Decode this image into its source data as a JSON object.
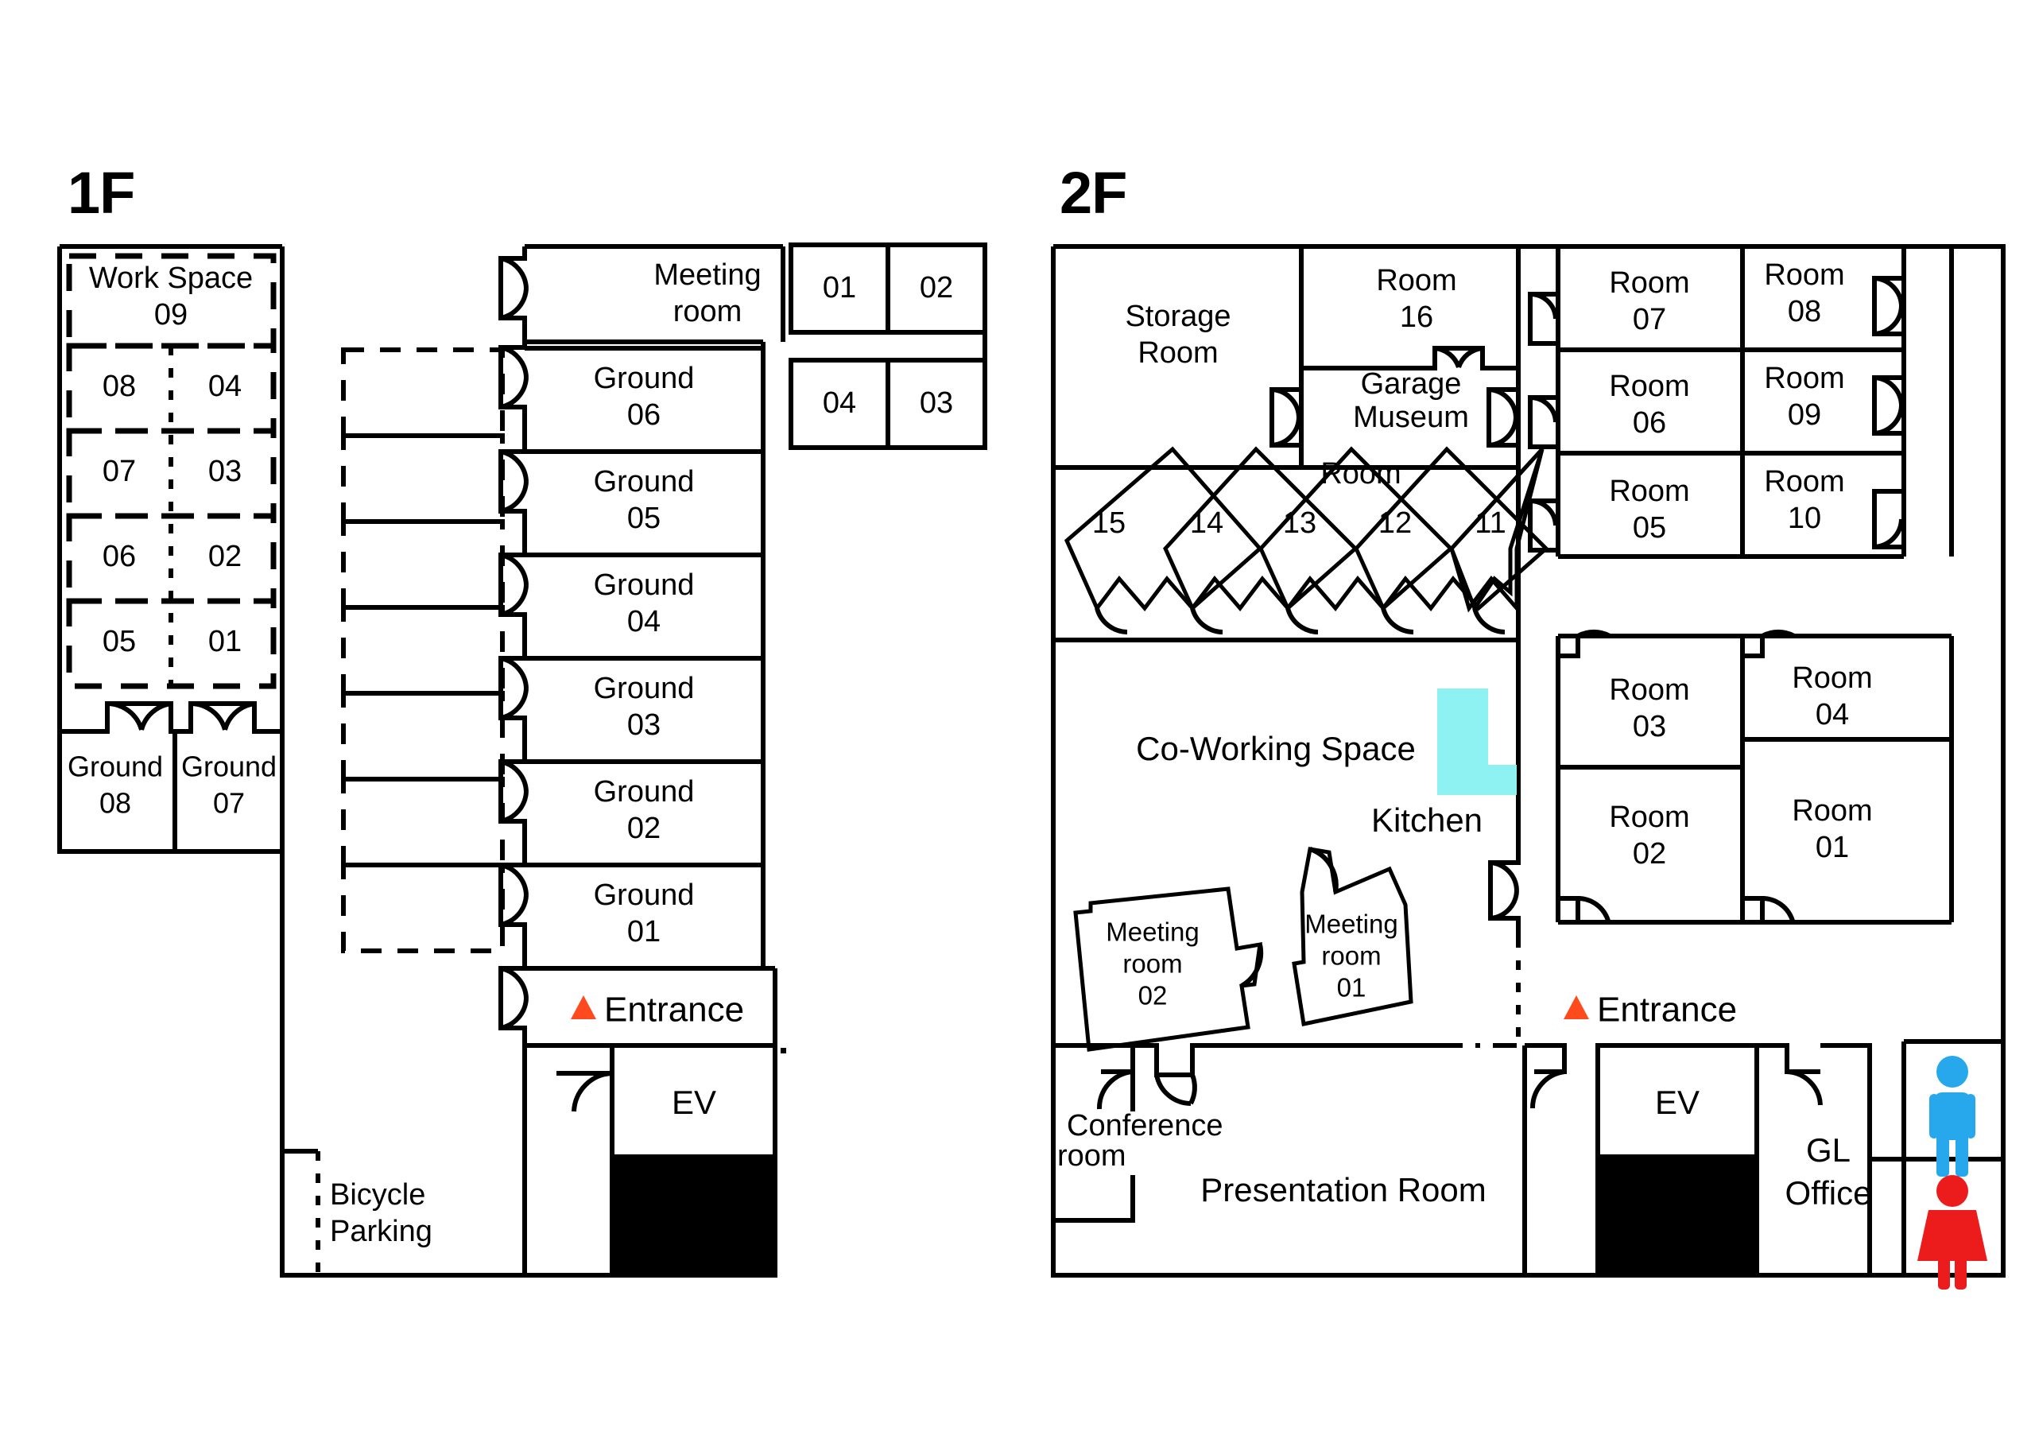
{
  "colors": {
    "wall": "#000000",
    "entrance_accent": "#FF4A1E",
    "kitchen_counter": "#8FF2F2",
    "restroom_male": "#27A8EC",
    "restroom_female": "#EC1C1C",
    "background": "#FFFFFF"
  },
  "floors": [
    {
      "id": "1F",
      "title": "1F",
      "work_space": {
        "label_line1": "Work Space",
        "label_line2": "09",
        "desks": [
          [
            "08",
            "04"
          ],
          [
            "07",
            "03"
          ],
          [
            "06",
            "02"
          ],
          [
            "05",
            "01"
          ]
        ]
      },
      "ground_rooms_left": [
        {
          "line1": "Ground",
          "line2": "08"
        },
        {
          "line1": "Ground",
          "line2": "07"
        }
      ],
      "ground_rooms_column": [
        {
          "line1": "Ground",
          "line2": "06"
        },
        {
          "line1": "Ground",
          "line2": "05"
        },
        {
          "line1": "Ground",
          "line2": "04"
        },
        {
          "line1": "Ground",
          "line2": "03"
        },
        {
          "line1": "Ground",
          "line2": "02"
        },
        {
          "line1": "Ground",
          "line2": "01"
        }
      ],
      "meeting_room": {
        "line1": "Meeting",
        "line2": "room"
      },
      "meeting_cells_top": [
        "01",
        "02"
      ],
      "meeting_cells_bottom": [
        "04",
        "03"
      ],
      "entrance": "Entrance",
      "ev": "EV",
      "bicycle_parking": {
        "line1": "Bicycle",
        "line2": "Parking"
      }
    },
    {
      "id": "2F",
      "title": "2F",
      "storage_room": {
        "line1": "Storage",
        "line2": "Room"
      },
      "room16": {
        "line1": "Room",
        "line2": "16"
      },
      "garage_museum": {
        "line1": "Garage",
        "line2": "Museum"
      },
      "angled_rooms_label": "Room",
      "angled_rooms": [
        "15",
        "14",
        "13",
        "12",
        "11"
      ],
      "co_working_space": "Co-Working Space",
      "kitchen": "Kitchen",
      "tilted_meeting_rooms": [
        {
          "line1": "Meeting",
          "line2": "room",
          "line3": "02"
        },
        {
          "line1": "Meeting",
          "line2": "room",
          "line3": "01"
        }
      ],
      "conference_room": {
        "line1": "Conference",
        "line2": "room"
      },
      "presentation_room": "Presentation Room",
      "entrance": "Entrance",
      "ev": "EV",
      "gl_office": {
        "line1": "GL",
        "line2": "Office"
      },
      "rooms_right_upper": [
        {
          "line1": "Room",
          "line2": "07"
        },
        {
          "line1": "Room",
          "line2": "08"
        },
        {
          "line1": "Room",
          "line2": "06"
        },
        {
          "line1": "Room",
          "line2": "09"
        },
        {
          "line1": "Room",
          "line2": "05"
        },
        {
          "line1": "Room",
          "line2": "10"
        }
      ],
      "rooms_right_lower": [
        {
          "line1": "Room",
          "line2": "03"
        },
        {
          "line1": "Room",
          "line2": "04"
        },
        {
          "line1": "Room",
          "line2": "02"
        },
        {
          "line1": "Room",
          "line2": "01"
        }
      ],
      "restrooms": [
        "male-restroom-icon",
        "female-restroom-icon"
      ]
    }
  ]
}
